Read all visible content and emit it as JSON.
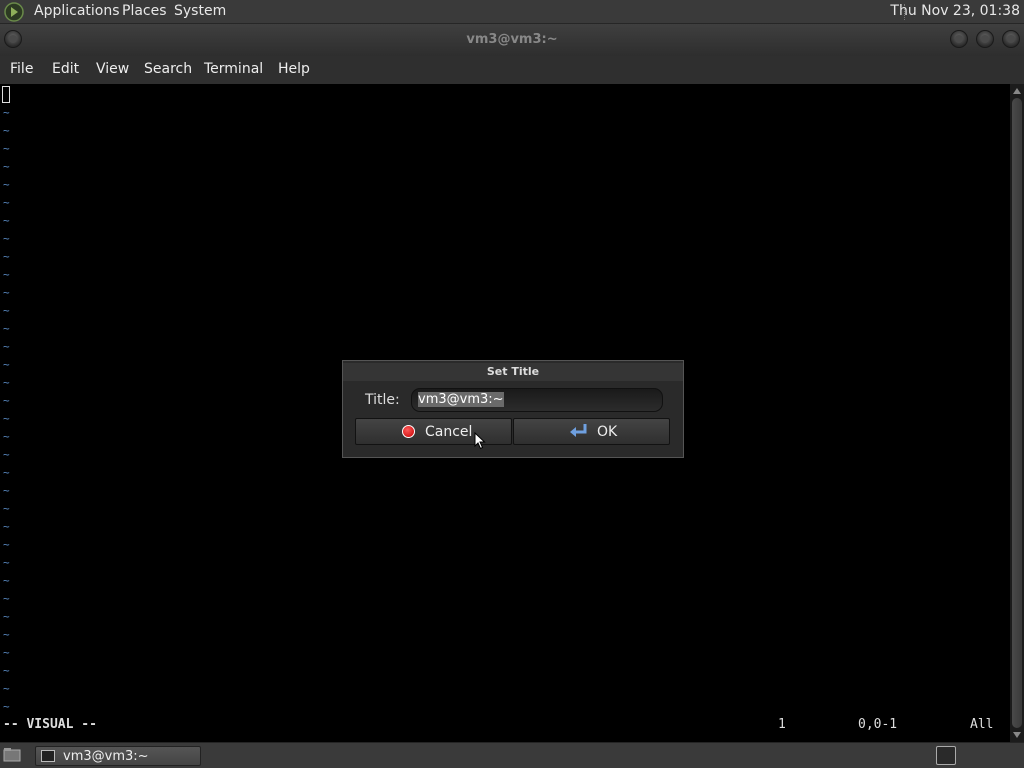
{
  "top_panel": {
    "menus": [
      "Applications",
      "Places",
      "System"
    ],
    "clock": "Thu Nov 23, 01:38"
  },
  "window": {
    "title": "vm3@vm3:~",
    "menus": [
      "File",
      "Edit",
      "View",
      "Search",
      "Terminal",
      "Help"
    ]
  },
  "terminal": {
    "filler_char": "~",
    "mode": "-- VISUAL --",
    "line": "1",
    "position": "0,0-1",
    "scroll": "All"
  },
  "dialog": {
    "title": "Set Title",
    "field_label": "Title:",
    "field_value": "vm3@vm3:~",
    "cancel_label": "Cancel",
    "ok_label": "OK"
  },
  "taskbar": {
    "task_label": "vm3@vm3:~"
  },
  "colors": {
    "tilde": "#5a8bc4",
    "cancel_icon": "#e00000",
    "ok_icon": "#6fa0e0"
  }
}
